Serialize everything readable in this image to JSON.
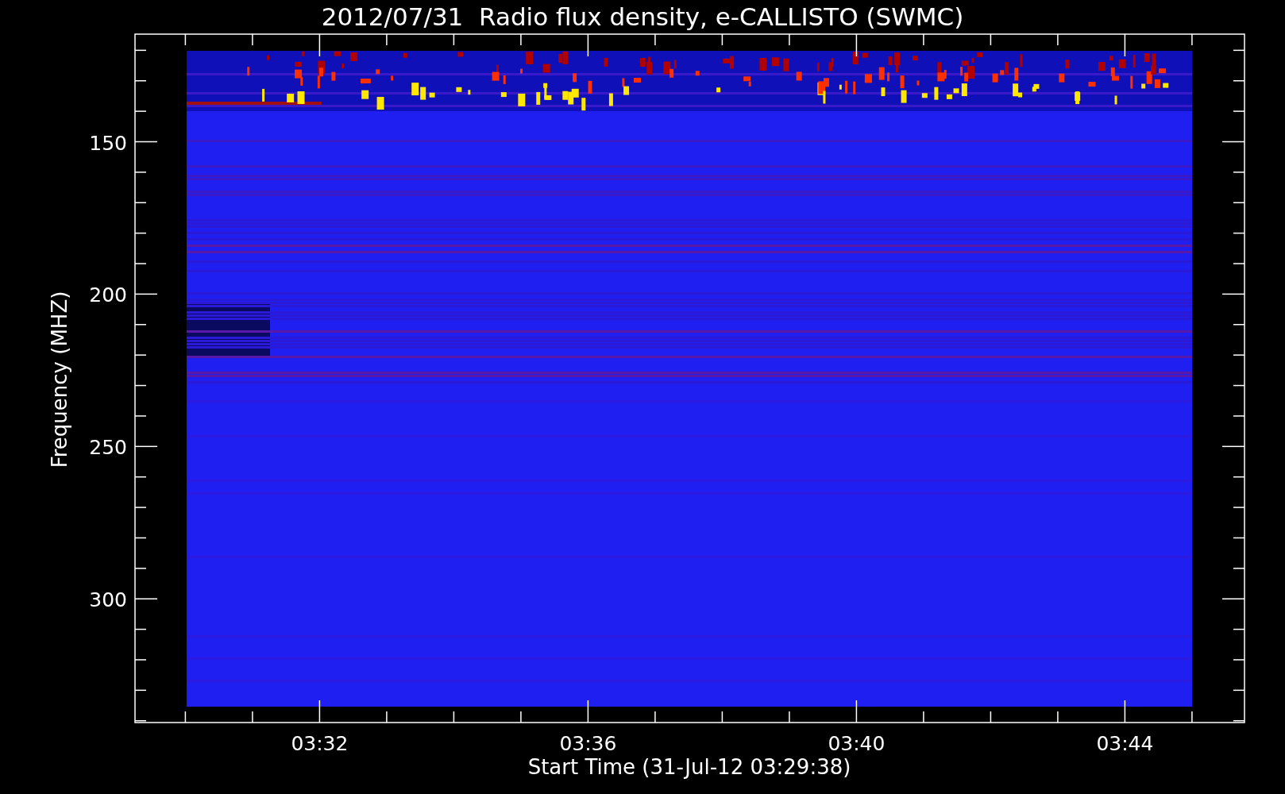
{
  "title": "2012/07/31  Radio flux density, e-CALLISTO (SWMC)",
  "y_axis": {
    "label": "Frequency (MHZ)",
    "ticks": [
      "150",
      "200",
      "250",
      "300"
    ]
  },
  "x_axis": {
    "label": "Start Time (31-Jul-12 03:29:38)",
    "ticks": [
      "03:32",
      "03:36",
      "03:40",
      "03:44"
    ]
  }
}
